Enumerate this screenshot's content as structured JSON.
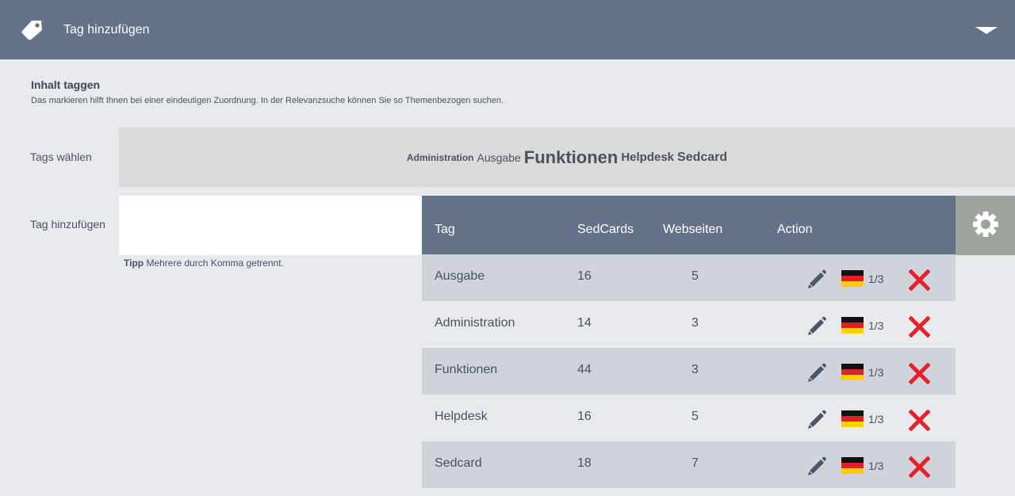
{
  "header": {
    "title": "Tag hinzufügen",
    "tag_icon": "tag-icon",
    "toggle_icon": "caret-down-icon"
  },
  "intro": {
    "title": "Inhalt taggen",
    "subtitle": "Das markieren hilft Ihnen bei einer eindeutigen Zuordnung. In der Relevanzsuche können Sie so Themenbezogen suchen."
  },
  "choose": {
    "label": "Tags wählen",
    "cloud": [
      "Administration",
      "Ausgabe",
      "Funktionen",
      "Helpdesk",
      "Sedcard"
    ]
  },
  "add": {
    "label": "Tag hinzufügen",
    "input_value": "",
    "input_placeholder": "",
    "tip_label": "Tipp",
    "tip_text": " Mehrere durch Komma getrennt."
  },
  "table": {
    "headers": [
      "Tag",
      "SedCards",
      "Webseiten",
      "Action"
    ],
    "rows": [
      {
        "tag": "Ausgabe",
        "sedcards": "16",
        "webseiten": "5",
        "lang": "1/3"
      },
      {
        "tag": "Administration",
        "sedcards": "14",
        "webseiten": "3",
        "lang": "1/3"
      },
      {
        "tag": "Funktionen",
        "sedcards": "44",
        "webseiten": "3",
        "lang": "1/3"
      },
      {
        "tag": "Helpdesk",
        "sedcards": "16",
        "webseiten": "5",
        "lang": "1/3"
      },
      {
        "tag": "Sedcard",
        "sedcards": "18",
        "webseiten": "7",
        "lang": "1/3"
      }
    ]
  },
  "icons": {
    "edit": "pencil-icon",
    "language": "german-flag-icon",
    "delete": "delete-x-icon",
    "settings": "gear-icon"
  },
  "colors": {
    "header": "#637288",
    "row_shade": "#cfd4da",
    "cloud_bg": "#dadada",
    "gear_bg": "#9ea39c",
    "delete": "#e5212b"
  }
}
